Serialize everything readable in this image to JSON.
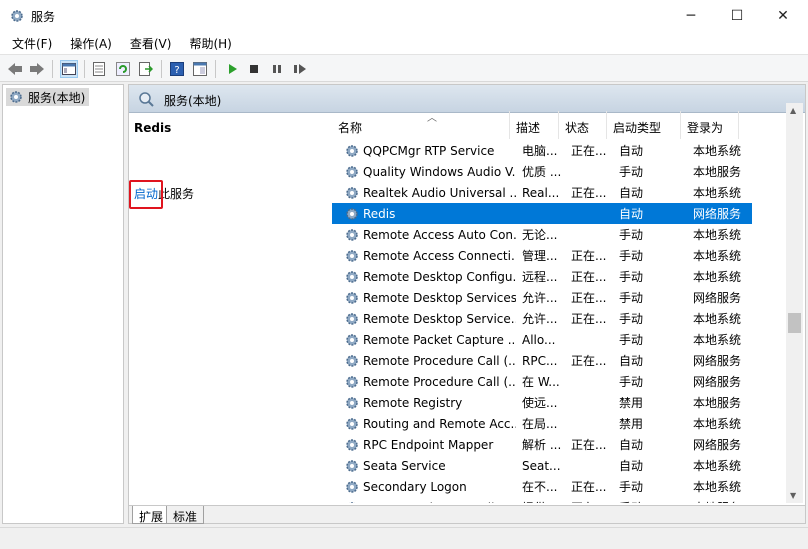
{
  "window": {
    "title": "服务",
    "minimize": "─",
    "maximize": "☐",
    "close": "✕"
  },
  "menu": [
    "文件(F)",
    "操作(A)",
    "查看(V)",
    "帮助(H)"
  ],
  "tree": {
    "root_label": "服务(本地)"
  },
  "right_header": {
    "title": "服务(本地)"
  },
  "selected_service": {
    "name": "Redis",
    "start_link": "启动",
    "start_suffix": "此服务"
  },
  "columns": {
    "name": "名称",
    "description": "描述",
    "status": "状态",
    "startup_type": "启动类型",
    "logon_as": "登录为"
  },
  "services": [
    {
      "name": "QQPCMgr RTP Service",
      "description": "电脑...",
      "status": "正在...",
      "startup_type": "自动",
      "logon_as": "本地系统"
    },
    {
      "name": "Quality Windows Audio V...",
      "description": "优质 ...",
      "status": "",
      "startup_type": "手动",
      "logon_as": "本地服务"
    },
    {
      "name": "Realtek Audio Universal ...",
      "description": "Real...",
      "status": "正在...",
      "startup_type": "自动",
      "logon_as": "本地系统"
    },
    {
      "name": "Redis",
      "description": "",
      "status": "",
      "startup_type": "自动",
      "logon_as": "网络服务"
    },
    {
      "name": "Remote Access Auto Con...",
      "description": "无论...",
      "status": "",
      "startup_type": "手动",
      "logon_as": "本地系统"
    },
    {
      "name": "Remote Access Connecti...",
      "description": "管理...",
      "status": "正在...",
      "startup_type": "手动",
      "logon_as": "本地系统"
    },
    {
      "name": "Remote Desktop Configu...",
      "description": "远程...",
      "status": "正在...",
      "startup_type": "手动",
      "logon_as": "本地系统"
    },
    {
      "name": "Remote Desktop Services",
      "description": "允许...",
      "status": "正在...",
      "startup_type": "手动",
      "logon_as": "网络服务"
    },
    {
      "name": "Remote Desktop Service...",
      "description": "允许...",
      "status": "正在...",
      "startup_type": "手动",
      "logon_as": "本地系统"
    },
    {
      "name": "Remote Packet Capture ...",
      "description": "Allo...",
      "status": "",
      "startup_type": "手动",
      "logon_as": "本地系统"
    },
    {
      "name": "Remote Procedure Call (...",
      "description": "RPC...",
      "status": "正在...",
      "startup_type": "自动",
      "logon_as": "网络服务"
    },
    {
      "name": "Remote Procedure Call (...",
      "description": "在 W...",
      "status": "",
      "startup_type": "手动",
      "logon_as": "网络服务"
    },
    {
      "name": "Remote Registry",
      "description": "使远...",
      "status": "",
      "startup_type": "禁用",
      "logon_as": "本地服务"
    },
    {
      "name": "Routing and Remote Acc...",
      "description": "在局...",
      "status": "",
      "startup_type": "禁用",
      "logon_as": "本地系统"
    },
    {
      "name": "RPC Endpoint Mapper",
      "description": "解析 ...",
      "status": "正在...",
      "startup_type": "自动",
      "logon_as": "网络服务"
    },
    {
      "name": "Seata Service",
      "description": "Seat...",
      "status": "",
      "startup_type": "自动",
      "logon_as": "本地系统"
    },
    {
      "name": "Secondary Logon",
      "description": "在不...",
      "status": "正在...",
      "startup_type": "手动",
      "logon_as": "本地系统"
    },
    {
      "name": "Secure Socket Tunneling...",
      "description": "提供...",
      "status": "正在...",
      "startup_type": "手动",
      "logon_as": "本地服务"
    }
  ],
  "selected_row_index": 3,
  "tabs": [
    "扩展",
    "标准"
  ],
  "colors": {
    "selection": "#0078d7",
    "link": "#0066cc",
    "highlight_box": "#e0141e",
    "play_icon": "#2ca02c"
  }
}
